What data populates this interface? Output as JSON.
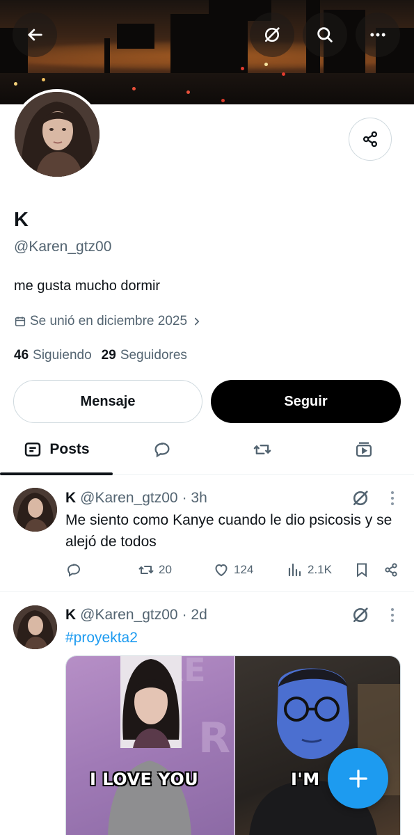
{
  "colors": {
    "accent": "#1d9bf0",
    "text": "#0f1419",
    "secondary_text": "#536471",
    "border": "#cfd9de",
    "follow_button_bg": "#000000"
  },
  "top_bar": {
    "back_icon": "arrow-left-icon",
    "grok_icon": "grok-icon",
    "search_icon": "search-icon",
    "more_icon": "more-horizontal-icon"
  },
  "profile": {
    "name": "K",
    "handle": "@Karen_gtz00",
    "bio": "me gusta mucho dormir",
    "joined": "Se unió en diciembre 2025",
    "following_count": "46",
    "following_label": "Siguiendo",
    "followers_count": "29",
    "followers_label": "Seguidores"
  },
  "actions": {
    "message_label": "Mensaje",
    "follow_label": "Seguir",
    "share_icon": "share-icon"
  },
  "tabs": {
    "posts_label": "Posts",
    "icons": [
      "posts-icon",
      "replies-icon",
      "reposts-icon",
      "videos-icon"
    ]
  },
  "tweets": [
    {
      "name": "K",
      "handle": "@Karen_gtz00",
      "time": "· 3h",
      "text": "Me siento como Kanye cuando le dio psicosis y se alejó de todos",
      "reposts": "20",
      "likes": "124",
      "views": "2.1K"
    },
    {
      "name": "K",
      "handle": "@Karen_gtz00",
      "time": "· 2d",
      "text": "#proyekta2",
      "media_captions": [
        "I LOVE YOU",
        "I'M"
      ]
    }
  ],
  "fab_icon": "plus-icon"
}
